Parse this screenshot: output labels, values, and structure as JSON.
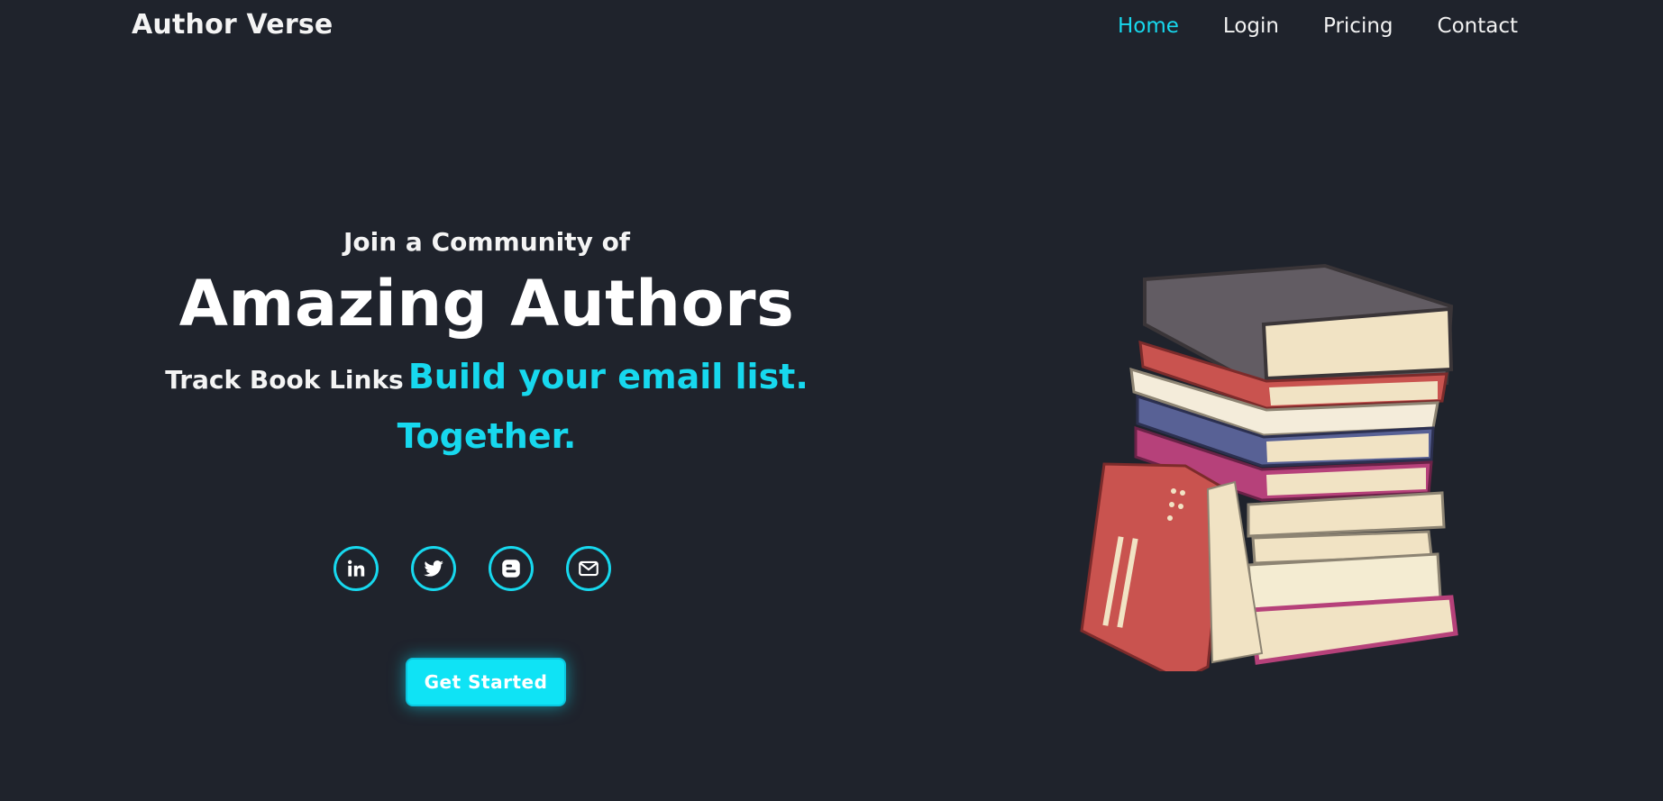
{
  "header": {
    "brand": "Author Verse",
    "nav": [
      {
        "label": "Home",
        "active": true
      },
      {
        "label": "Login",
        "active": false
      },
      {
        "label": "Pricing",
        "active": false
      },
      {
        "label": "Contact",
        "active": false
      }
    ]
  },
  "hero": {
    "kicker": "Join a Community of",
    "headline": "Amazing Authors",
    "tagline_prefix": "Track Book Links",
    "tagline_accent_1": "Build your email list.",
    "tagline_accent_2": "Together.",
    "cta_label": "Get Started"
  },
  "socials": [
    {
      "icon": "linkedin-icon"
    },
    {
      "icon": "twitter-icon"
    },
    {
      "icon": "blogger-icon"
    },
    {
      "icon": "mail-icon"
    }
  ],
  "illustration": {
    "icon": "book-stack-icon"
  },
  "colors": {
    "background": "#1f232c",
    "accent": "#17d8ee",
    "button": "#0fe3f5"
  }
}
